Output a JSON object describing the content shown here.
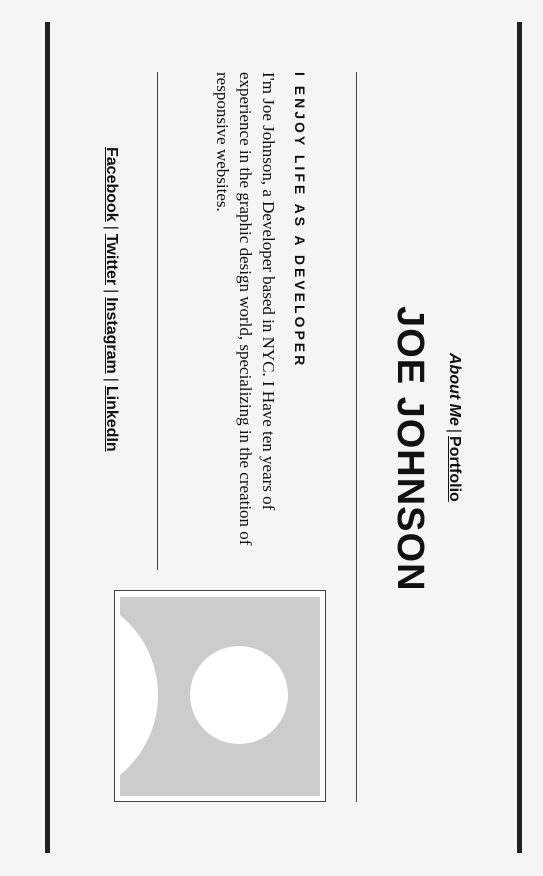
{
  "nav": {
    "about_label": "About Me",
    "separator": "|",
    "portfolio_label": "Portfolio"
  },
  "header": {
    "name": "JOE JOHNSON"
  },
  "intro": {
    "heading": "I ENJOY LIFE AS A DEVELOPER",
    "bio": "I'm Joe Johnson, a Developer based in NYC. I Have ten years of experience in the graphic design world, specializing in the creation of responsive websites."
  },
  "social": {
    "separator": "|",
    "links": [
      "Facebook",
      "Twitter",
      "Instagram",
      "LinkedIn"
    ]
  },
  "photo": {
    "icon": "avatar-placeholder-icon",
    "background_color": "#cccccc",
    "figure_color": "#ffffff"
  },
  "colors": {
    "page_background": "#f5f5f5",
    "border": "#222222",
    "text": "#111111"
  }
}
